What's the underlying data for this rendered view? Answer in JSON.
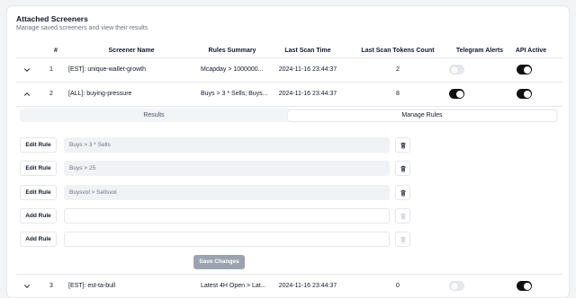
{
  "page": {
    "title": "Attached Screeners",
    "subtitle": "Manage saved screeners and view their results"
  },
  "table": {
    "headers": {
      "num": "#",
      "name": "Screener Name",
      "rules": "Rules Summary",
      "last_scan": "Last Scan Time",
      "tokens": "Last Scan Tokens Count",
      "telegram": "Telegram Alerts",
      "api": "API Active"
    },
    "rows": [
      {
        "num": "1",
        "name": "[EST]: unique-wallet-growth",
        "rules": "Mcapday > 1000000...",
        "last_scan": "2024-11-16 23:44:37",
        "tokens": "2",
        "telegram_on": false,
        "api_on": true,
        "expanded": false
      },
      {
        "num": "2",
        "name": "[ALL]: buying-pressure",
        "rules": "Buys > 3 * Sells; Buys...",
        "last_scan": "2024-11-16 23:44:37",
        "tokens": "8",
        "telegram_on": true,
        "api_on": true,
        "expanded": true
      },
      {
        "num": "3",
        "name": "[EST]: est-ta-bull",
        "rules": "Latest 4H Open > Lat...",
        "last_scan": "2024-11-16 23:44:37",
        "tokens": "0",
        "telegram_on": false,
        "api_on": true,
        "expanded": false
      }
    ]
  },
  "detail": {
    "tabs": [
      {
        "label": "Results",
        "active": false
      },
      {
        "label": "Manage Rules",
        "active": true
      }
    ],
    "rules": [
      {
        "button": "Edit Rule",
        "value": "Buys > 3 * Sells",
        "placeholder": ""
      },
      {
        "button": "Edit Rule",
        "value": "Buys > 25",
        "placeholder": ""
      },
      {
        "button": "Edit Rule",
        "value": "Buysvol > Sellsvol",
        "placeholder": ""
      },
      {
        "button": "Add Rule",
        "value": "",
        "placeholder": ""
      },
      {
        "button": "Add Rule",
        "value": "",
        "placeholder": ""
      }
    ],
    "save_label": "Save Changes"
  },
  "icons": {
    "collapsed": "chevron-down-icon",
    "expanded": "chevron-up-icon",
    "delete": "trash-icon"
  },
  "colors": {
    "toggle_on": "#111111",
    "toggle_off": "#e5e7eb",
    "save_button": "#9ca3af"
  }
}
